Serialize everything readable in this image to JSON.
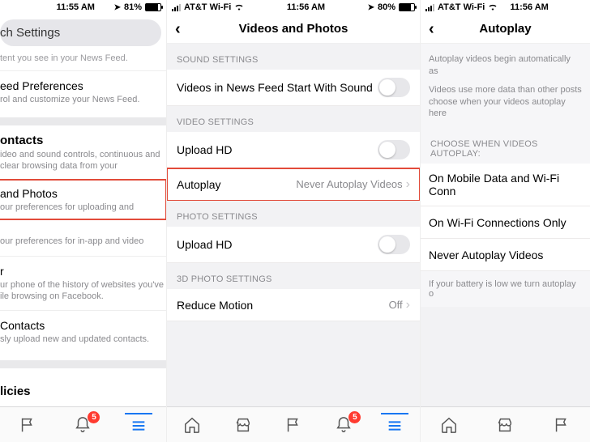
{
  "panel0": {
    "status": {
      "time": "11:55 AM",
      "battery_pct": "81%",
      "battery_fill": 81
    },
    "search_pill": "ch Settings",
    "faint_line": "tent you see in your News Feed.",
    "pref_title": "eed Preferences",
    "pref_desc": "rol and customize your News Feed.",
    "section2_title": "ontacts",
    "section2_desc": "ideo and sound controls, continuous and clear browsing data from your",
    "item_vp_title": "and Photos",
    "item_vp_desc": "our preferences for uploading and",
    "item_sounds_desc": "our preferences for in-app and video",
    "item_browser_title": "r",
    "item_browser_desc": "ur phone of the history of websites you've ile browsing on Facebook.",
    "item_contacts_title": "Contacts",
    "item_contacts_desc": "sly upload new and updated contacts.",
    "policies_title": "licies",
    "bell_badge": "5"
  },
  "panel1": {
    "status": {
      "carrier": "AT&T Wi-Fi",
      "time": "11:56 AM",
      "battery_pct": "80%",
      "battery_fill": 80
    },
    "title": "Videos and Photos",
    "sec_sound": "SOUND SETTINGS",
    "row_sound_label": "Videos in News Feed Start With Sound",
    "sec_video": "VIDEO SETTINGS",
    "row_uploadhd": "Upload HD",
    "row_autoplay": "Autoplay",
    "row_autoplay_value": "Never Autoplay Videos",
    "sec_photo": "PHOTO SETTINGS",
    "row_photo_uploadhd": "Upload HD",
    "sec_3d": "3D PHOTO SETTINGS",
    "row_reduce": "Reduce Motion",
    "row_reduce_value": "Off",
    "bell_badge": "5"
  },
  "panel2": {
    "status": {
      "carrier": "AT&T Wi-Fi",
      "time": "11:56 AM"
    },
    "title": "Autoplay",
    "intro1": "Autoplay videos begin automatically as",
    "intro2": "Videos use more data than other posts choose when your videos autoplay here",
    "sec_hdr": "CHOOSE WHEN VIDEOS AUTOPLAY:",
    "opt1": "On Mobile Data and Wi-Fi Conn",
    "opt2": "On Wi-Fi Connections Only",
    "opt3": "Never Autoplay Videos",
    "footnote": "If your battery is low we turn autoplay o"
  }
}
